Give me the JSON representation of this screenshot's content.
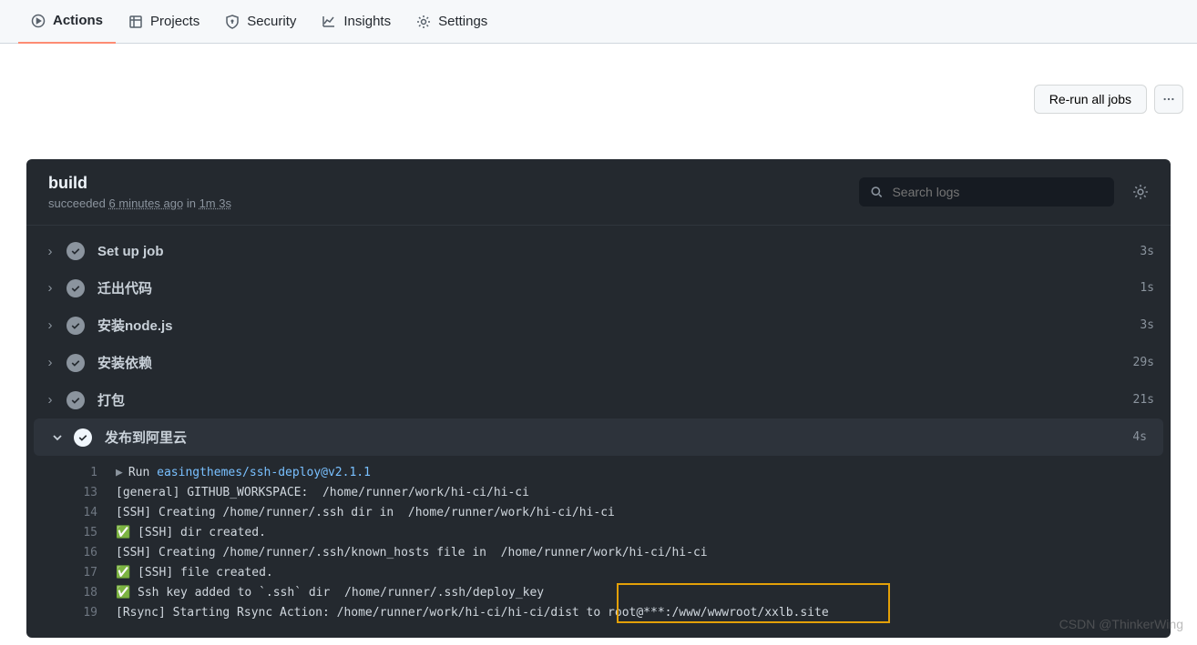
{
  "nav": {
    "items": [
      {
        "label": "Actions",
        "active": true,
        "icon": "play"
      },
      {
        "label": "Projects",
        "active": false,
        "icon": "project"
      },
      {
        "label": "Security",
        "active": false,
        "icon": "shield"
      },
      {
        "label": "Insights",
        "active": false,
        "icon": "graph"
      },
      {
        "label": "Settings",
        "active": false,
        "icon": "gear"
      }
    ]
  },
  "actions": {
    "rerun_label": "Re-run all jobs"
  },
  "job": {
    "title": "build",
    "status": "succeeded",
    "when": "6 minutes ago",
    "in": "in",
    "duration": "1m 3s"
  },
  "search": {
    "placeholder": "Search logs"
  },
  "steps": [
    {
      "name": "Set up job",
      "time": "3s",
      "expanded": false
    },
    {
      "name": "迁出代码",
      "time": "1s",
      "expanded": false
    },
    {
      "name": "安装node.js",
      "time": "3s",
      "expanded": false
    },
    {
      "name": "安装依赖",
      "time": "29s",
      "expanded": false
    },
    {
      "name": "打包",
      "time": "21s",
      "expanded": false
    },
    {
      "name": "发布到阿里云",
      "time": "4s",
      "expanded": true
    }
  ],
  "log": {
    "run_prefix": "Run ",
    "run_cmd": "easingthemes/ssh-deploy@v2.1.1",
    "lines": [
      {
        "n": "1",
        "t": "▶ Run easingthemes/ssh-deploy@v2.1.1"
      },
      {
        "n": "13",
        "t": "[general] GITHUB_WORKSPACE:  /home/runner/work/hi-ci/hi-ci"
      },
      {
        "n": "14",
        "t": "[SSH] Creating /home/runner/.ssh dir in  /home/runner/work/hi-ci/hi-ci"
      },
      {
        "n": "15",
        "t": "✅ [SSH] dir created."
      },
      {
        "n": "16",
        "t": "[SSH] Creating /home/runner/.ssh/known_hosts file in  /home/runner/work/hi-ci/hi-ci"
      },
      {
        "n": "17",
        "t": "✅ [SSH] file created."
      },
      {
        "n": "18",
        "t": "✅ Ssh key added to `.ssh` dir  /home/runner/.ssh/deploy_key"
      },
      {
        "n": "19",
        "t": "[Rsync] Starting Rsync Action: /home/runner/work/hi-ci/hi-ci/dist to root@***:/www/wwwroot/xxlb.site"
      }
    ]
  },
  "watermark": "CSDN @ThinkerWing"
}
